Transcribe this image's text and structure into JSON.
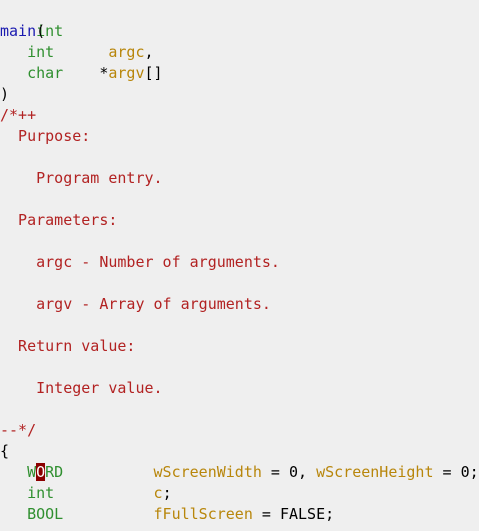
{
  "lines": [
    {
      "text": "int",
      "kind": "type"
    },
    {
      "text": "main",
      "kind": "func",
      "paren": "("
    },
    {
      "indent": "   ",
      "type": "int",
      "gap": "      ",
      "ident": "argc",
      "tail": ","
    },
    {
      "indent": "   ",
      "type": "char",
      "gap": "    *",
      "ident": "argv",
      "tail": "[]"
    },
    {
      "text": ")"
    },
    {
      "text": "/*++"
    },
    {
      "text": "  Purpose:"
    },
    {
      "text": ""
    },
    {
      "text": "    Program entry."
    },
    {
      "text": ""
    },
    {
      "text": "  Parameters:"
    },
    {
      "text": ""
    },
    {
      "text": "    argc - Number of arguments."
    },
    {
      "text": ""
    },
    {
      "text": "    argv - Array of arguments."
    },
    {
      "text": ""
    },
    {
      "text": "  Return value:"
    },
    {
      "text": ""
    },
    {
      "text": "    Integer value."
    },
    {
      "text": ""
    },
    {
      "text": "--*/"
    },
    {
      "text": "{"
    },
    {
      "indent": "   ",
      "type_pre": "W",
      "type_cursor": "O",
      "type_post": "RD",
      "gap": "          ",
      "ident1": "wScreenWidth",
      "mid": " = 0, ",
      "ident2": "wScreenHeight",
      "tail": " = 0;"
    },
    {
      "indent": "   ",
      "type": "int",
      "gap": "           ",
      "ident": "c",
      "tail": ";"
    },
    {
      "indent": "   ",
      "type": "BOOL",
      "gap": "          ",
      "ident": "fFullScreen",
      "tail": " = FALSE;"
    }
  ],
  "colors": {
    "background": "#efefef",
    "type": "#2f8f2f",
    "function": "#1a1ab0",
    "identifier": "#b8860b",
    "comment": "#b22222",
    "cursor": "#8b0000"
  }
}
